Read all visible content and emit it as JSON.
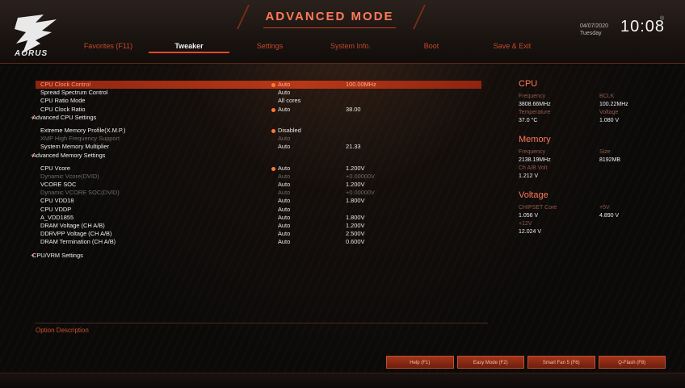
{
  "header": {
    "mode_title": "ADVANCED MODE",
    "logo_text": "AORUS",
    "date": "04/07/2020",
    "weekday": "Tuesday",
    "time": "10:08",
    "tabs": [
      {
        "label": "Favorites (F11)",
        "active": false
      },
      {
        "label": "Tweaker",
        "active": true
      },
      {
        "label": "Settings",
        "active": false
      },
      {
        "label": "System Info.",
        "active": false
      },
      {
        "label": "Boot",
        "active": false
      },
      {
        "label": "Save & Exit",
        "active": false
      }
    ]
  },
  "settings": [
    {
      "name": "CPU Clock Control",
      "val1": "Auto",
      "val2": "100.00MHz",
      "bullet": true,
      "selected": true
    },
    {
      "name": "Spread Spectrum Control",
      "val1": "Auto",
      "val2": ""
    },
    {
      "name": "CPU Ratio Mode",
      "val1": "All cores",
      "val2": ""
    },
    {
      "name": "CPU Clock Ratio",
      "val1": "Auto",
      "val2": "38.00",
      "bullet": true
    },
    {
      "name": "Advanced CPU Settings",
      "sub": true
    },
    {
      "gap": true
    },
    {
      "name": "Extreme Memory Profile(X.M.P.)",
      "val1": "Disabled",
      "val2": "",
      "bullet": true
    },
    {
      "name": "XMP High Frequency Support",
      "val1": "Auto",
      "val2": "",
      "dim": true
    },
    {
      "name": "System Memory Multiplier",
      "val1": "Auto",
      "val2": "21.33"
    },
    {
      "name": "Advanced Memory Settings",
      "sub": true
    },
    {
      "gap": true
    },
    {
      "name": "CPU Vcore",
      "val1": "Auto",
      "val2": "1.200V",
      "bullet": true
    },
    {
      "name": "Dynamic Vcore(DVID)",
      "val1": "Auto",
      "val2": "+0.00000V",
      "dim": true
    },
    {
      "name": "VCORE SOC",
      "val1": "Auto",
      "val2": "1.200V"
    },
    {
      "name": "Dynamic VCORE SOC(DVID)",
      "val1": "Auto",
      "val2": "+0.00000V",
      "dim": true
    },
    {
      "name": "CPU VDD18",
      "val1": "Auto",
      "val2": "1.800V"
    },
    {
      "name": "CPU VDDP",
      "val1": "Auto",
      "val2": ""
    },
    {
      "name": "A_VDD1855",
      "val1": "Auto",
      "val2": "1.800V"
    },
    {
      "name": "DRAM Voltage     (CH A/B)",
      "val1": "Auto",
      "val2": "1.200V"
    },
    {
      "name": "DDRVPP Voltage   (CH A/B)",
      "val1": "Auto",
      "val2": "2.500V"
    },
    {
      "name": "DRAM Termination  (CH A/B)",
      "val1": "Auto",
      "val2": "0.600V"
    },
    {
      "gap": true
    },
    {
      "name": "CPU/VRM Settings",
      "sub": true
    }
  ],
  "option_description": "Option Description",
  "side": {
    "cpu": {
      "title": "CPU",
      "frequency_label": "Frequency",
      "frequency": "3808.66MHz",
      "bclk_label": "BCLK",
      "bclk": "100.22MHz",
      "temperature_label": "Temperature",
      "temperature": "37.0 °C",
      "voltage_label": "Voltage",
      "voltage": "1.080 V"
    },
    "memory": {
      "title": "Memory",
      "frequency_label": "Frequency",
      "frequency": "2138.19MHz",
      "size_label": "Size",
      "size": "8192MB",
      "volt_label": "Ch A/B Volt",
      "volt": "1.212 V"
    },
    "voltage": {
      "title": "Voltage",
      "chipset_label": "CHIPSET Core",
      "chipset": "1.056 V",
      "p5v_label": "+5V",
      "p5v": "4.890 V",
      "p12v_label": "+12V",
      "p12v": "12.024 V"
    }
  },
  "footer": {
    "buttons": [
      "Help (F1)",
      "Easy Mode (F2)",
      "Smart Fan 5 (F6)",
      "Q-Flash (F8)"
    ]
  },
  "colors": {
    "accent": "#e04a25",
    "title": "#ff7a5a",
    "panel_label": "#8f5a4a"
  }
}
